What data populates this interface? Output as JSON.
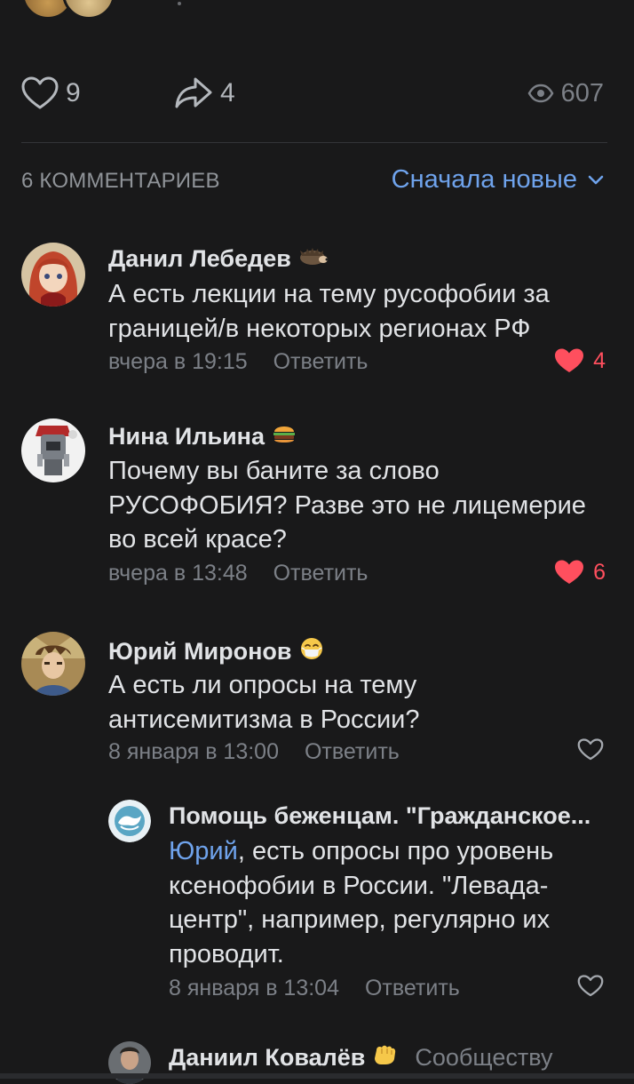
{
  "post_stats": {
    "likes": "9",
    "shares": "4",
    "views": "607"
  },
  "comments_header": {
    "title": "6 КОММЕНТАРИЕВ",
    "sort_label": "Сначала новые"
  },
  "comments": [
    {
      "author": "Данил Лебедев",
      "text": "А есть лекции на тему русофобии за границей/в некоторых регионах РФ",
      "time": "вчера в 19:15",
      "reply_label": "Ответить",
      "likes": "4"
    },
    {
      "author": "Нина Ильина",
      "text": "Почему вы баните за слово РУСОФОБИЯ? Разве это не лицемерие во всей красе?",
      "time": "вчера в 13:48",
      "reply_label": "Ответить",
      "likes": "6"
    },
    {
      "author": "Юрий Миронов",
      "text": "А есть ли опросы на тему антисемитизма в России?",
      "time": "8 января в 13:00",
      "reply_label": "Ответить",
      "likes": ""
    },
    {
      "author": "Помощь беженцам. \"Гражданское...",
      "mention": "Юрий",
      "text": ", есть опросы про уровень ксенофобии в России. \"Левада-центр\", например, регулярно их проводит.",
      "time": "8 января в 13:04",
      "reply_label": "Ответить",
      "likes": ""
    },
    {
      "author": "Даниил Ковалёв",
      "community_label": "Сообществу"
    }
  ],
  "colors": {
    "background": "#19191a",
    "text": "#e1e3e6",
    "secondary": "#7c8087",
    "accent": "#6fa3ec",
    "like_active": "#ff4f5e"
  },
  "icons": [
    "heart-icon",
    "share-icon",
    "eye-icon",
    "chevron-down-icon",
    "hedgehog-badge-icon",
    "burger-badge-icon",
    "mask-smile-badge-icon",
    "fist-badge-icon"
  ]
}
